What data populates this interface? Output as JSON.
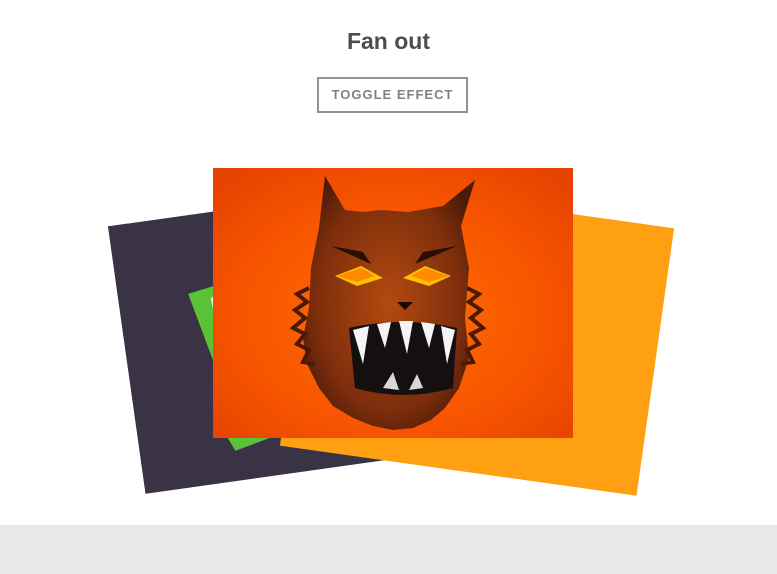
{
  "header": {
    "title": "Fan out",
    "toggle_label": "TOGGLE EFFECT"
  },
  "stack": {
    "cards": [
      {
        "id": "left",
        "background": "#3a3346",
        "illustration": "green-monster-icon"
      },
      {
        "id": "center",
        "background": "#f75200",
        "illustration": "werewolf-icon"
      },
      {
        "id": "right",
        "background": "#ff9f12",
        "illustration": "plain"
      }
    ]
  },
  "colors": {
    "title": "#4a4f4c",
    "button_border": "#8e9490",
    "footer": "#e8e8e8"
  }
}
